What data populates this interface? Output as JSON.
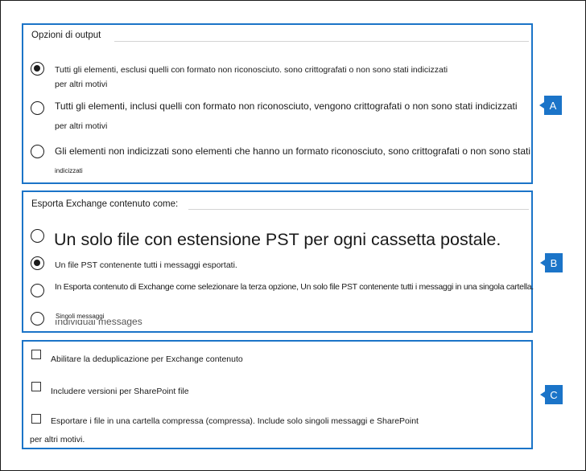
{
  "output_options": {
    "title": "Opzioni di output",
    "options": [
      {
        "label": "Tutti gli elementi, esclusi quelli con formato non riconosciuto. sono crittografati o non sono stati indicizzati",
        "continuation": "per altri motivi",
        "selected": true
      },
      {
        "label": "Tutti gli elementi, inclusi quelli con formato non riconosciuto, vengono crittografati o non sono stati indicizzati",
        "continuation": "per altri motivi",
        "selected": false
      },
      {
        "label": "Gli elementi non indicizzati sono elementi che hanno un formato riconosciuto, sono crittografati o non sono stati",
        "continuation": "indicizzati",
        "selected": false
      }
    ]
  },
  "export_as": {
    "title": "Esporta Exchange contenuto come:",
    "options": [
      {
        "label": "Un solo file con estensione PST per ogni cassetta postale.",
        "selected": false
      },
      {
        "label": "Un file PST contenente tutti i messaggi esportati.",
        "selected": true
      },
      {
        "label": "In Esporta contenuto di Exchange come selezionare la terza opzione, Un solo file PST contenente tutti i messaggi in una singola cartella.",
        "selected": false
      },
      {
        "label": "Singoli messaggi",
        "underlying_label": "Individual messages",
        "selected": false
      }
    ]
  },
  "checkbox_options": [
    {
      "label": "Abilitare la deduplicazione per Exchange contenuto",
      "checked": false
    },
    {
      "label": "Includere versioni per SharePoint file",
      "checked": false
    },
    {
      "label": "Esportare i file in una cartella compressa (compressa). Include solo singoli messaggi e SharePoint",
      "continuation": "per altri motivi.",
      "checked": false
    }
  ],
  "callouts": {
    "a": "A",
    "b": "B",
    "c": "C"
  },
  "colors": {
    "accent": "#1b74c8",
    "text": "#1a1a1a"
  }
}
